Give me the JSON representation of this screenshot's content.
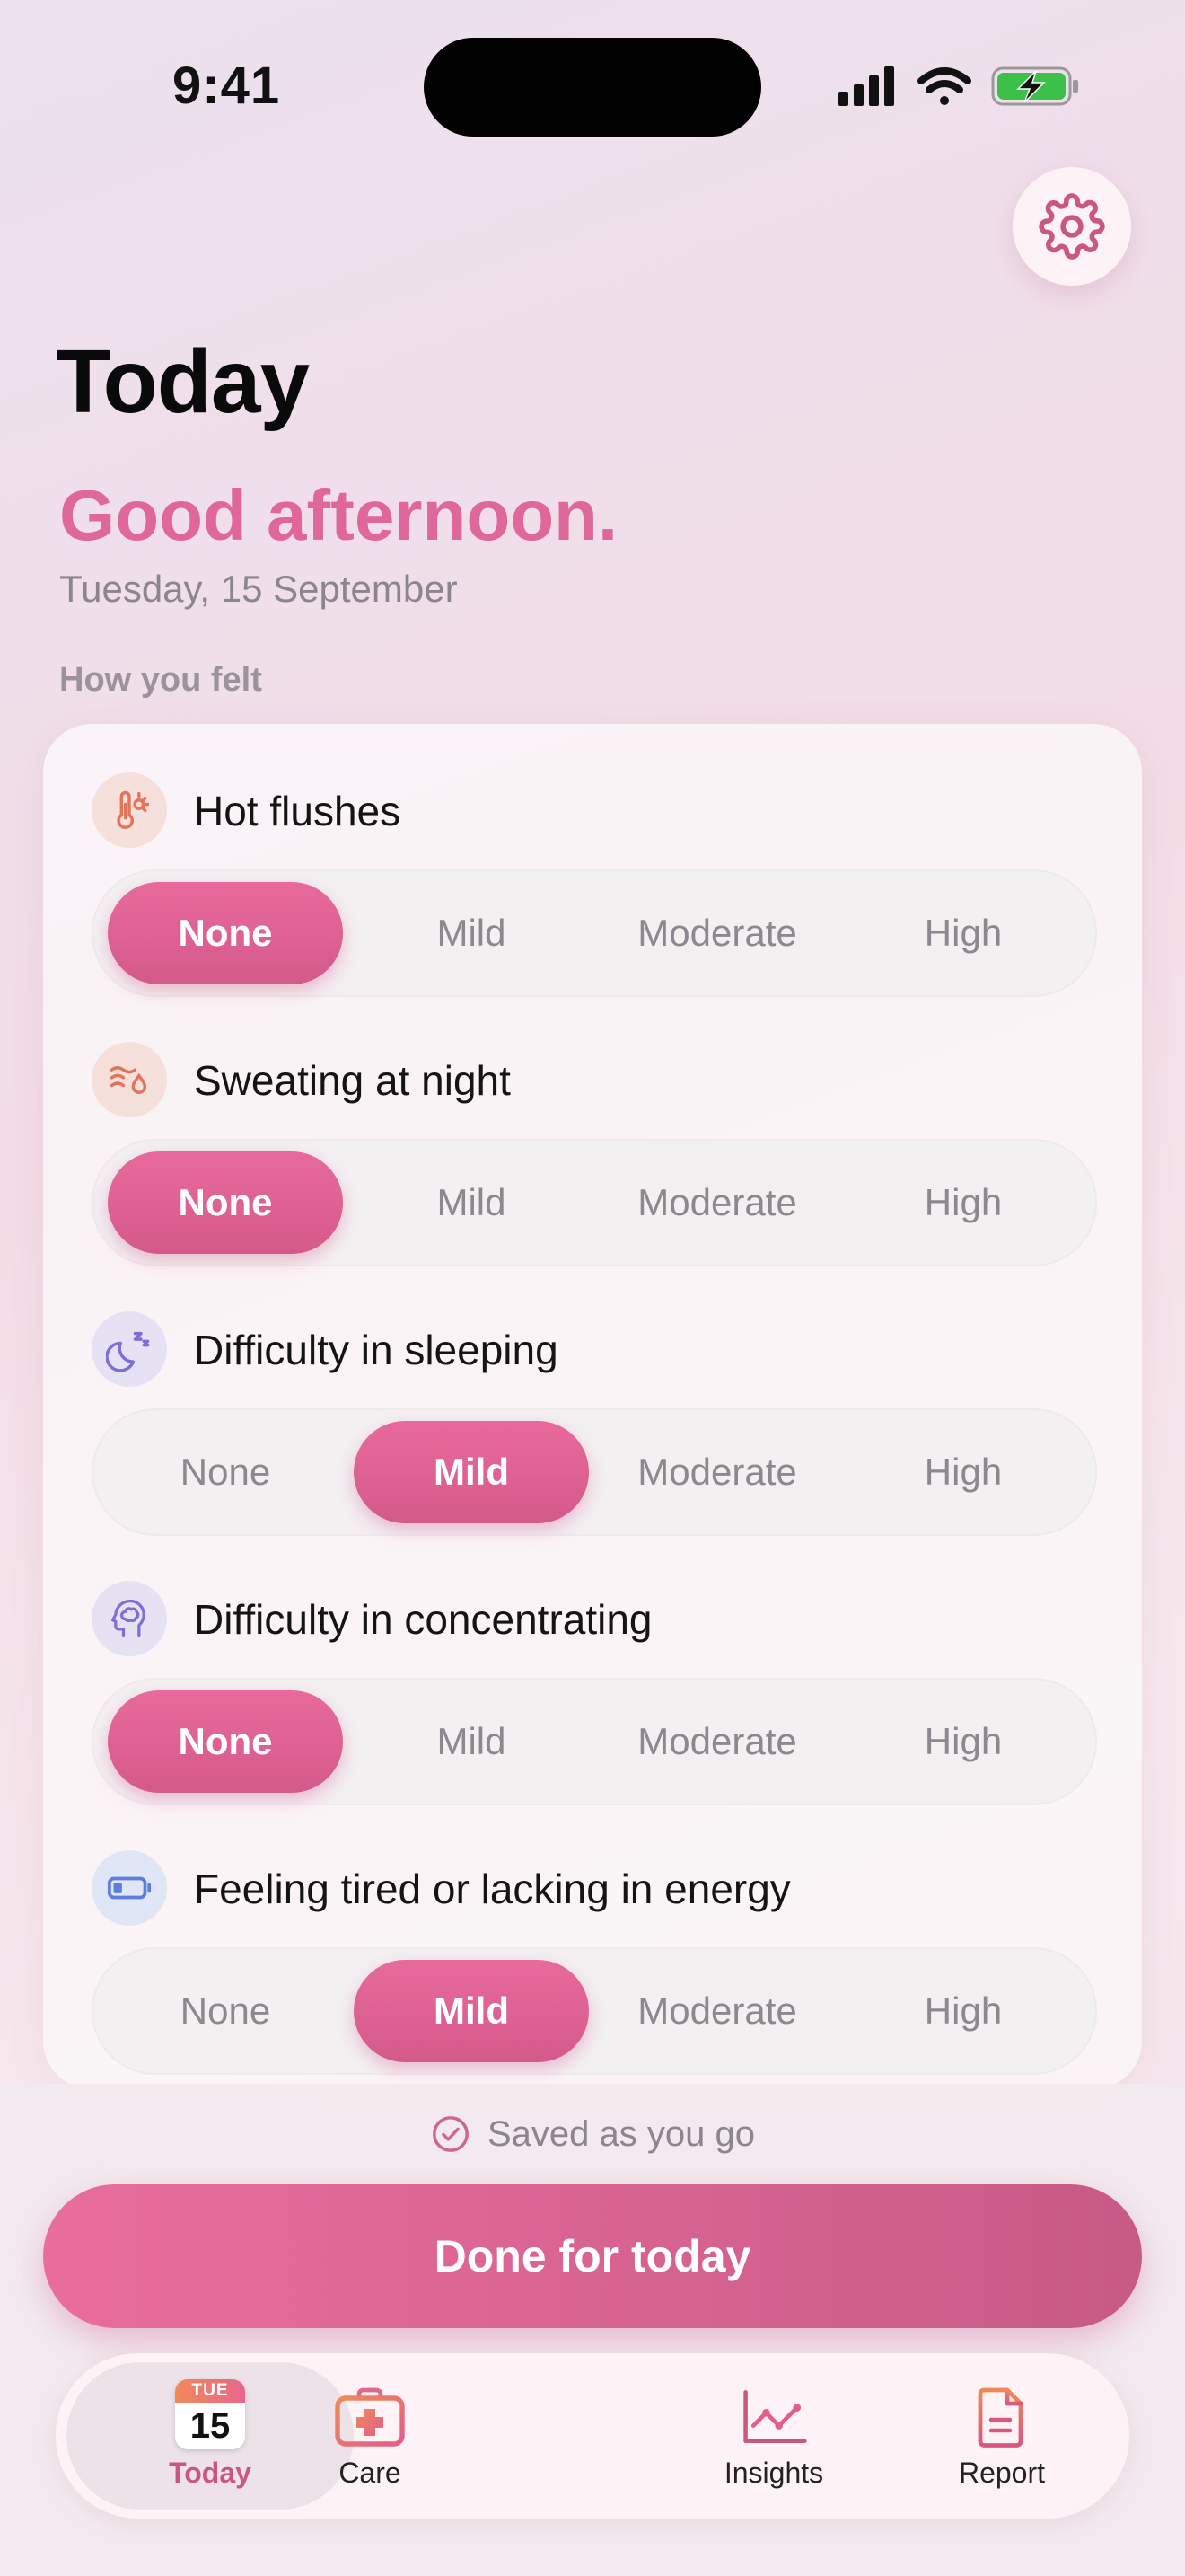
{
  "status_bar": {
    "time": "9:41"
  },
  "header": {
    "title": "Today",
    "greeting": "Good afternoon.",
    "date": "Tuesday, 15 September",
    "section_label": "How you felt"
  },
  "severity_options": [
    "None",
    "Mild",
    "Moderate",
    "High"
  ],
  "symptoms": [
    {
      "title": "Hot flushes",
      "icon": "thermometer-sun-icon",
      "selected": "None"
    },
    {
      "title": "Sweating at night",
      "icon": "sweat-drop-icon",
      "selected": "None"
    },
    {
      "title": "Difficulty in sleeping",
      "icon": "moon-zzz-icon",
      "selected": "Mild"
    },
    {
      "title": "Difficulty in concentrating",
      "icon": "head-brain-icon",
      "selected": "None"
    },
    {
      "title": "Feeling tired or lacking in energy",
      "icon": "low-battery-icon",
      "selected": "Mild"
    }
  ],
  "footer": {
    "saved_text": "Saved as you go",
    "done_label": "Done for today"
  },
  "tabbar": {
    "calendar_day": "TUE",
    "calendar_date": "15",
    "tabs": [
      {
        "label": "Today",
        "icon": "calendar-icon",
        "active": true
      },
      {
        "label": "Care",
        "icon": "first-aid-kit-icon",
        "active": false
      },
      {
        "label": "Insights",
        "icon": "line-chart-icon",
        "active": false
      },
      {
        "label": "Report",
        "icon": "document-icon",
        "active": false
      }
    ]
  },
  "colors": {
    "accent": "#e0679a",
    "accent_dark": "#c85a86",
    "muted_text": "#8b8590",
    "sheet_bg": "#f2eaee"
  }
}
